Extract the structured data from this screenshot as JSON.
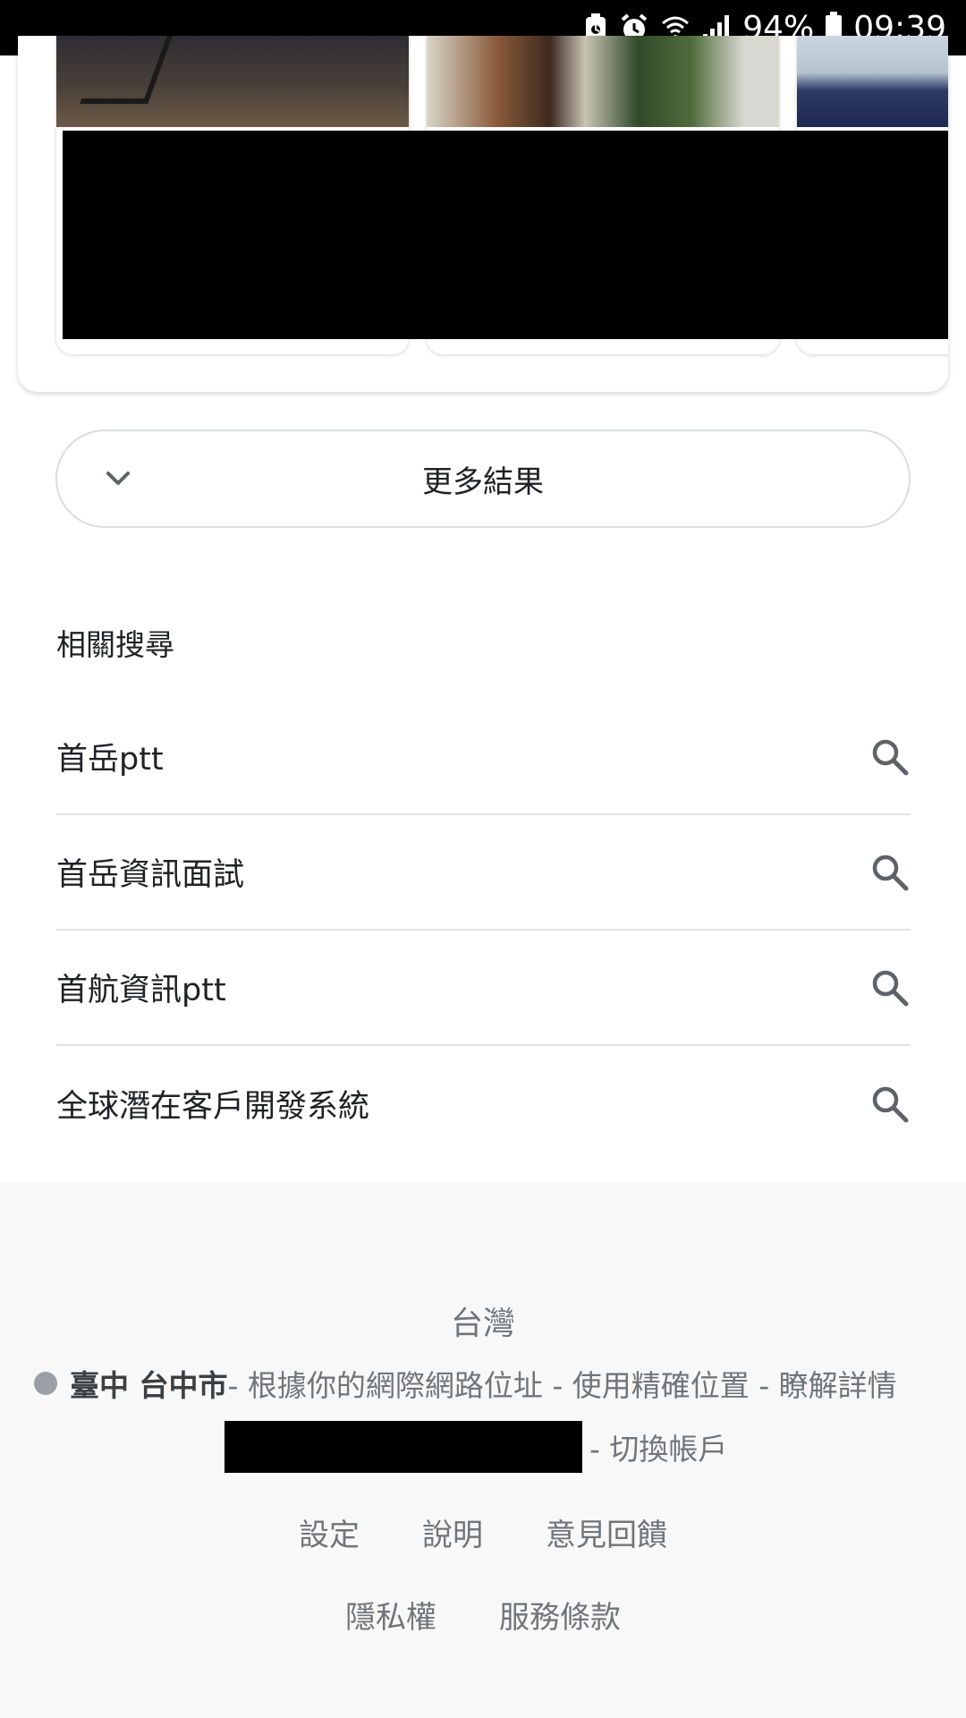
{
  "status_bar": {
    "battery_percent": "94%",
    "time": "09:39",
    "icons": [
      "battery-saver-icon",
      "alarm-icon",
      "wifi-icon",
      "signal-icon",
      "battery-icon"
    ]
  },
  "more_results": {
    "label": "更多結果"
  },
  "related": {
    "heading": "相關搜尋",
    "items": [
      {
        "label": "首岳ptt"
      },
      {
        "label": "首岳資訊面試"
      },
      {
        "label": "首航資訊ptt"
      },
      {
        "label": "全球潛在客戶開發系統"
      }
    ]
  },
  "footer": {
    "country": "台灣",
    "location_city": "臺中 台中市",
    "location_rest": " - 根據你的網際網路位址 - 使用精確位置 - 瞭解詳情",
    "switch_account": "- 切換帳戶",
    "links_row1": [
      "設定",
      "說明",
      "意見回饋"
    ],
    "links_row2": [
      "隱私權",
      "服務條款"
    ]
  },
  "colors": {
    "text_primary": "#202124",
    "text_secondary": "#70757a",
    "divider": "#e0e0e0",
    "footer_bg": "#f8f8f8"
  }
}
